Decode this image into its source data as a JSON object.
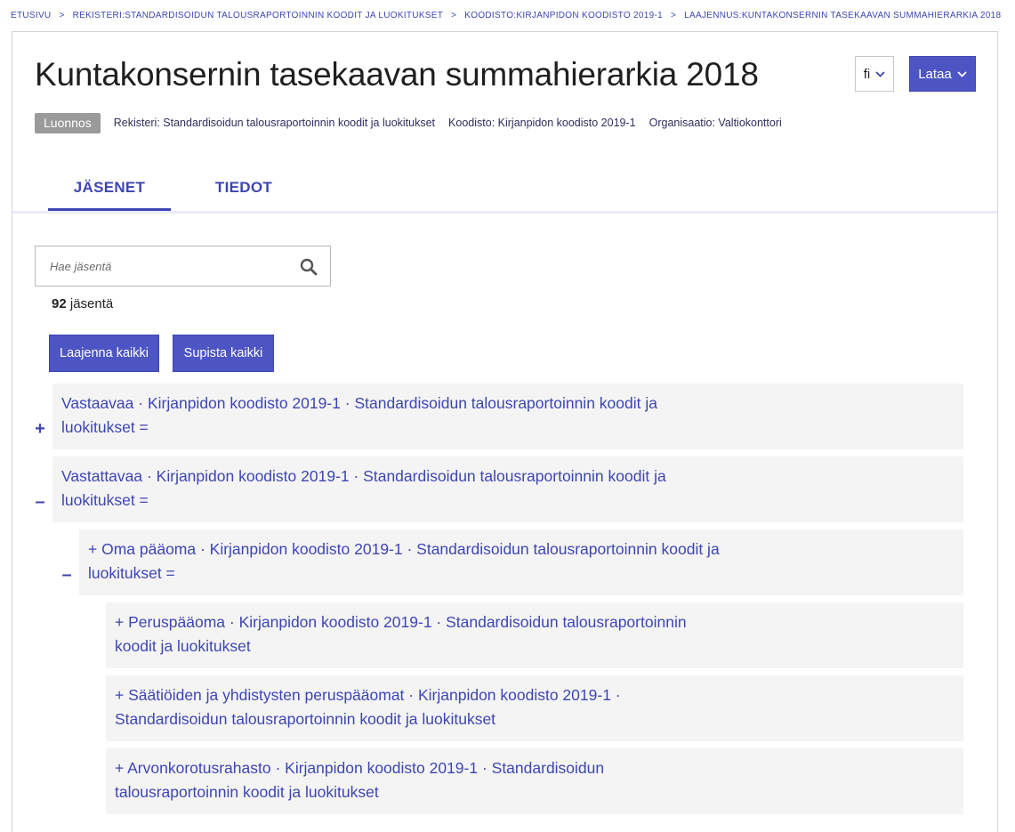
{
  "breadcrumb": [
    {
      "label": "ETUSIVU"
    },
    {
      "label": "REKISTERI:STANDARDISOIDUN TALOUSRAPORTOINNIN KOODIT JA LUOKITUKSET"
    },
    {
      "label": "KOODISTO:KIRJANPIDON KOODISTO 2019-1"
    },
    {
      "label": "LAAJENNUS:KUNTAKONSERNIN TASEKAAVAN SUMMAHIERARKIA 2018"
    }
  ],
  "header": {
    "title": "Kuntakonsernin tasekaavan summahierarkia 2018",
    "language": "fi",
    "download_label": "Lataa",
    "status_badge": "Luonnos",
    "registry": "Rekisteri: Standardisoidun talousraportoinnin koodit ja luokitukset",
    "codelist": "Koodisto: Kirjanpidon koodisto 2019-1",
    "organization": "Organisaatio: Valtiokonttori"
  },
  "tabs": [
    {
      "label": "JÄSENET",
      "active": true
    },
    {
      "label": "TIEDOT",
      "active": false
    }
  ],
  "search": {
    "placeholder": "Hae jäsentä",
    "value": ""
  },
  "members": {
    "count": "92",
    "count_suffix": "jäsentä"
  },
  "actions": {
    "expand_all": "Laajenna kaikki",
    "collapse_all": "Supista kaikki"
  },
  "tree": [
    {
      "toggle": "+",
      "line1": "Vastaavaa · Kirjanpidon koodisto 2019-1 · Standardisoidun talousraportoinnin koodit ja",
      "line2": "luokitukset ="
    },
    {
      "toggle": "–",
      "line1": "Vastattavaa · Kirjanpidon koodisto 2019-1 · Standardisoidun talousraportoinnin koodit ja",
      "line2": "luokitukset ="
    },
    {
      "toggle": "–",
      "line1": "+ Oma pääoma · Kirjanpidon koodisto 2019-1 · Standardisoidun talousraportoinnin koodit ja",
      "line2": "luokitukset ="
    },
    {
      "toggle": "",
      "line1": "+ Peruspääoma · Kirjanpidon koodisto 2019-1 · Standardisoidun talousraportoinnin",
      "line2": "koodit ja luokitukset"
    },
    {
      "toggle": "",
      "line1": "+ Säätiöiden ja yhdistysten peruspääomat · Kirjanpidon koodisto 2019-1 ·",
      "line2": "Standardisoidun talousraportoinnin koodit ja luokitukset"
    },
    {
      "toggle": "",
      "line1": "+ Arvonkorotusrahasto · Kirjanpidon koodisto 2019-1 · Standardisoidun",
      "line2": "talousraportoinnin koodit ja luokitukset"
    }
  ],
  "colors": {
    "accent": "#3d46b2",
    "button": "#4d55c4",
    "badge": "#9a9a9a",
    "row_bg": "#f4f4f4"
  },
  "icons": {
    "search": "search-icon",
    "chevron": "chevron-down-icon",
    "expand": "plus-icon",
    "collapse": "minus-icon"
  }
}
